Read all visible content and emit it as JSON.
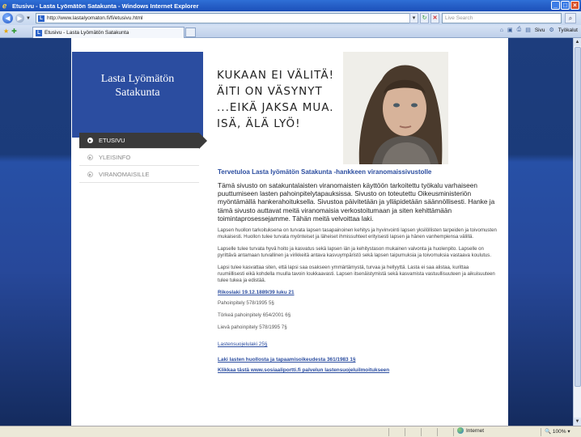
{
  "window": {
    "title": "Etusivu - Lasta Lyömätön Satakunta - Windows Internet Explorer",
    "min_glyph": "_",
    "max_glyph": "□",
    "close_glyph": "×"
  },
  "address": {
    "url": "http://www.lastalyomaton.fi/fi/etusivu.html",
    "search_placeholder": "Live Search"
  },
  "tab": {
    "label": "Etusivu - Lasta Lyömätön Satakunta"
  },
  "commandbar": {
    "page_label": "Sivu",
    "tools_label": "Työkalut"
  },
  "site": {
    "logo_line1": "Lasta Lyömätön",
    "logo_line2": "Satakunta",
    "hero_lines": [
      "KUKAAN EI VÄLITÄ!",
      "ÄITI ON VÄSYNYT",
      "...EIKÄ JAKSA MUA.",
      "ISÄ, ÄLÄ LYÖ!"
    ],
    "nav": [
      {
        "label": "ETUSIVU",
        "active": true
      },
      {
        "label": "YLEISINFO",
        "active": false
      },
      {
        "label": "VIRANOMAISILLE",
        "active": false
      }
    ]
  },
  "content": {
    "title": "Tervetuloa Lasta lyömätön Satakunta -hankkeen viranomaissivustolle",
    "lead": "Tämä sivusto on satakuntalaisten viranomaisten käyttöön tarkoitettu työkalu varhaiseen puuttumiseen lasten pahoinpitelytapauksissa. Sivusto on toteutettu Oikeusministeriön myöntämällä hankerahoituksella. Sivustoa päivitetään ja ylläpidetään säännöllisesti. Hanke ja tämä sivusto auttavat meitä viranomaisia verkostoitumaan ja siten kehittämään toimintaprosessejamme. Tähän meitä velvoittaa laki.",
    "para1": "Lapsen huollon tarkoituksena on turvata lapsen tasapainoinen kehitys ja hyvinvointi lapsen yksilöllisten tarpeiden ja toivomusten mukaisesti. Huollon tulee turvata myönteiset ja läheiset ihmissuhteet erityisesti lapsen ja hänen vanhempiensa välillä.",
    "para2": "Lapselle tulee turvata hyvä hoito ja kasvatus sekä lapsen iän ja kehitystason mukainen valvonta ja huolenpito. Lapselle on pyrittävä antamaan turvallinen ja virikkeitä antava kasvuympäristö sekä lapsen taipumuksia ja toivomuksia vastaava koulutus.",
    "para3": "Lapsi tulee kasvattaa siten, että lapsi saa osakseen ymmärtämystä, turvaa ja hellyyttä. Lasta ei saa alistaa, kurittaa ruumiillisesti eikä kohdella muulla tavoin loukkaavasti. Lapsen itsenäistymistä sekä kasvamista vastuullisuuteen ja aikuisuuteen tulee tukea ja edistää.",
    "link1": "Rikoslaki 19.12.1889/39 luku 21",
    "law1": "Pahoinpitely 578/1995 5§",
    "law2": "Törkeä pahoinpitely 654/2001 6§",
    "law3": "Lievä pahoinpitely 578/1995 7§",
    "link2": "Lastensuojelulaki 25§",
    "link3": "Laki lasten huollosta ja tapaamisoikeudesta 361/1983 1§",
    "link4": "Klikkaa tästä www.sosiaaliportti.fi palvelun lastensuojeluilmoitukseen"
  },
  "status": {
    "zone": "Internet",
    "zoom": "100%"
  }
}
